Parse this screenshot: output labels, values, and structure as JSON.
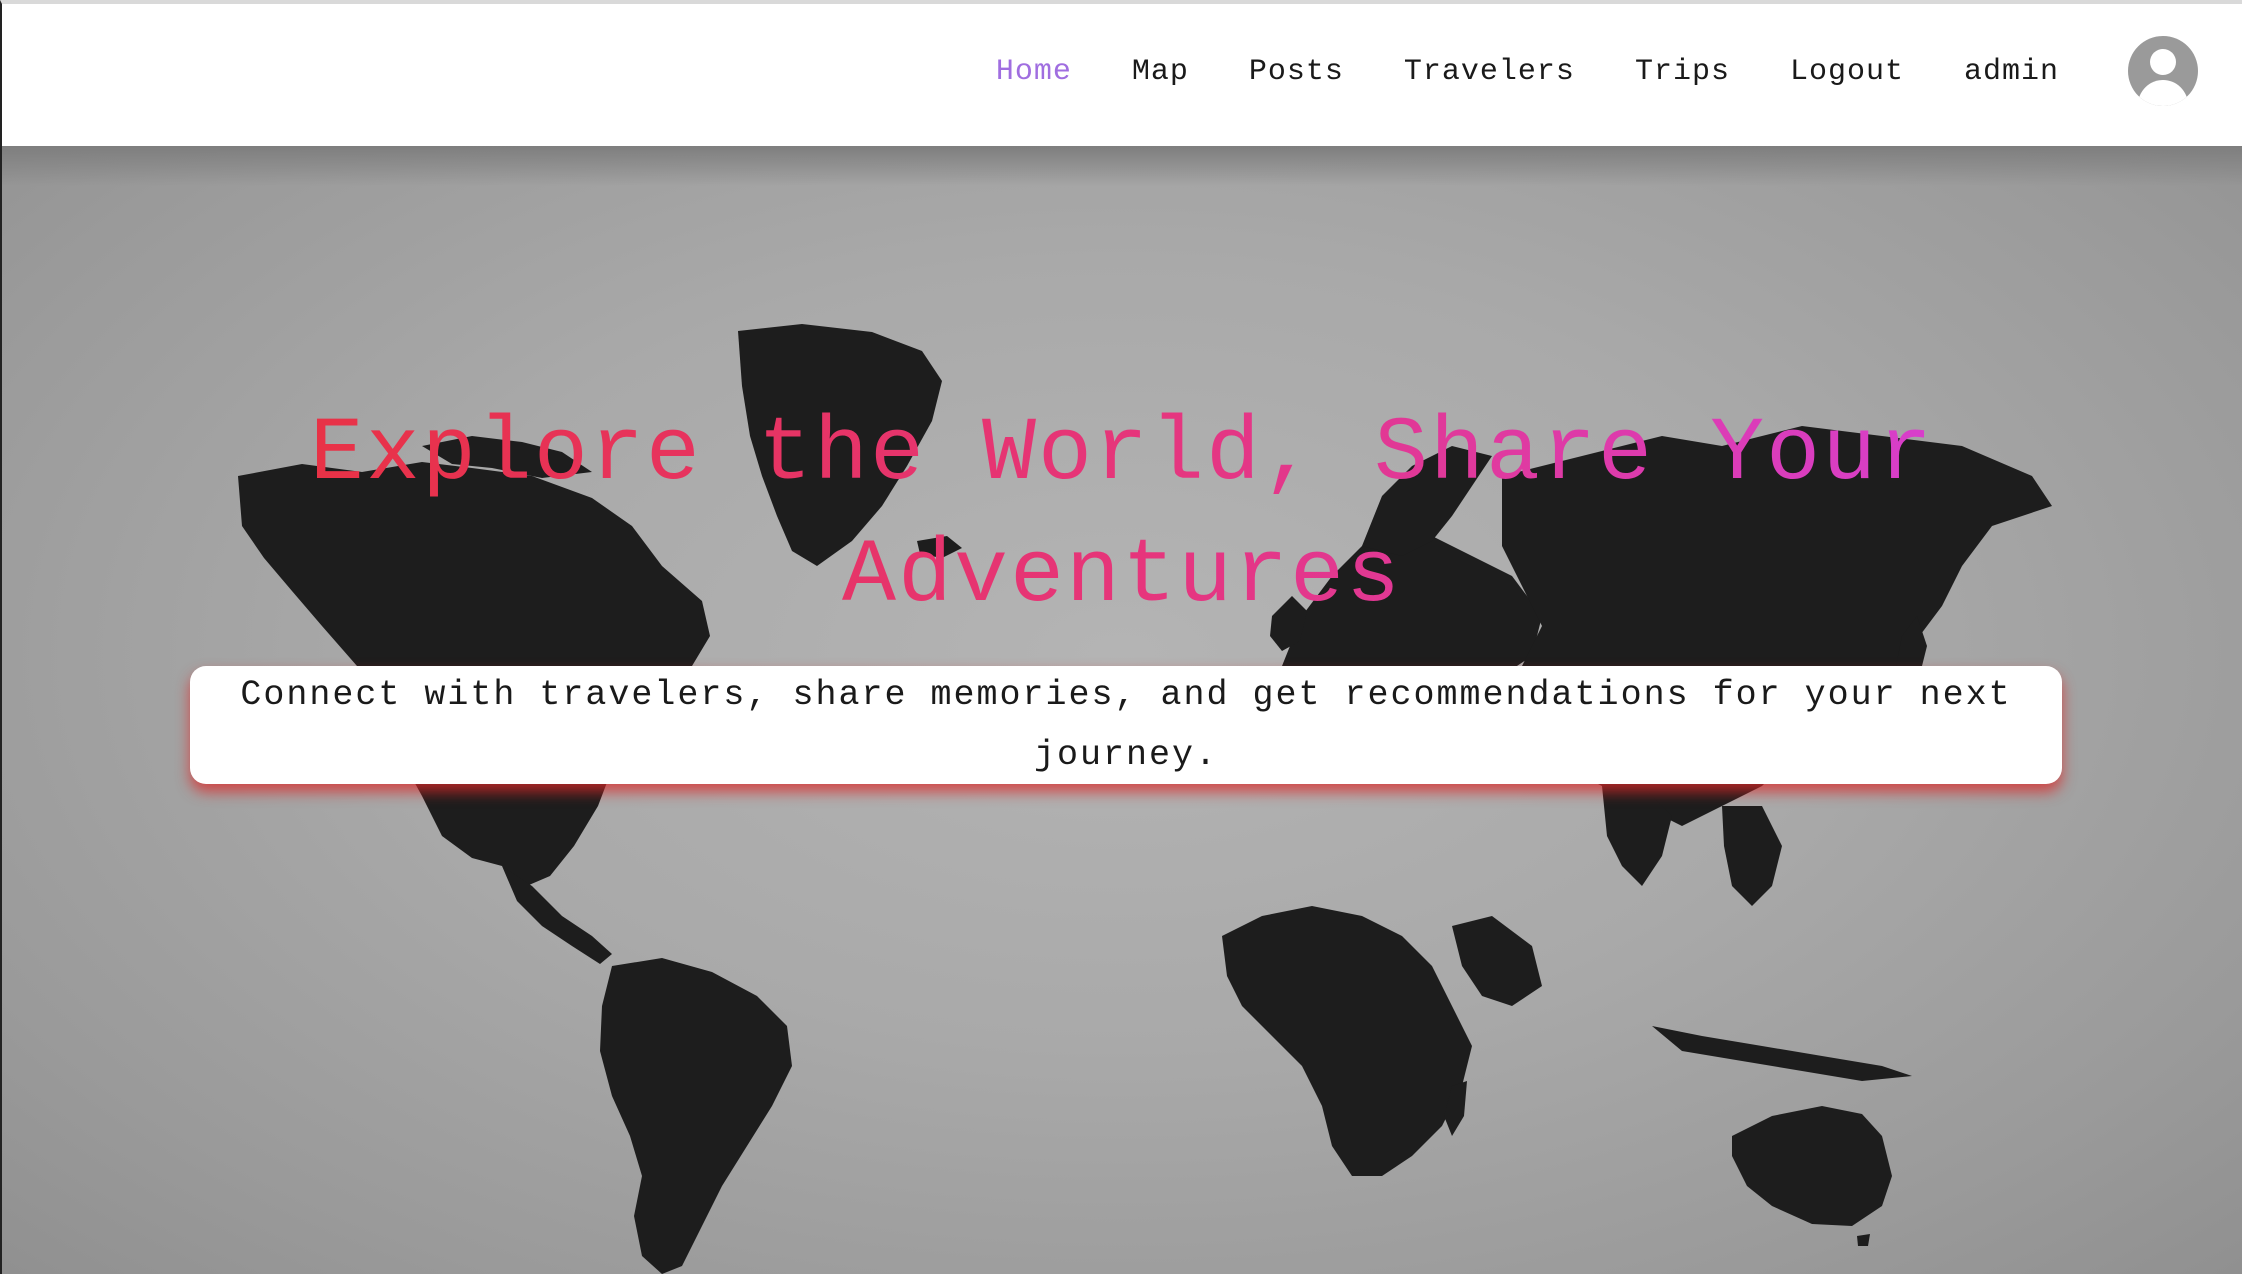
{
  "nav": {
    "items": [
      {
        "label": "Home",
        "active": true
      },
      {
        "label": "Map",
        "active": false
      },
      {
        "label": "Posts",
        "active": false
      },
      {
        "label": "Travelers",
        "active": false
      },
      {
        "label": "Trips",
        "active": false
      },
      {
        "label": "Logout",
        "active": false
      },
      {
        "label": "admin",
        "active": false
      }
    ],
    "avatar_icon": "user-avatar-icon",
    "active_color": "#a06ee0"
  },
  "hero": {
    "title": "Explore the World, Share Your Adventures",
    "subtitle": "Connect with travelers, share memories, and get recommendations for your next journey.",
    "background": "world-map-image",
    "title_gradient": [
      "#e8313f",
      "#e6357a",
      "#d640d6"
    ],
    "subtitle_shadow_color": "#dc2828"
  }
}
